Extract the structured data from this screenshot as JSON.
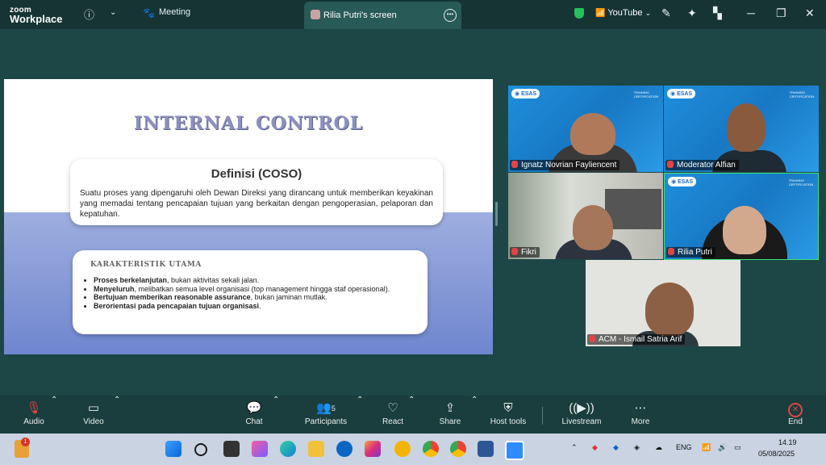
{
  "titlebar": {
    "logo_line1": "zoom",
    "logo_line2": "Workplace",
    "meeting_label": "Meeting",
    "screen_tab_label": "Rilia Putri's screen",
    "youtube_label": "YouTube"
  },
  "slide": {
    "title": "INTERNAL CONTROL",
    "card1_heading": "Definisi (COSO)",
    "card1_text": "Suatu proses yang dipengaruhi oleh Dewan Direksi yang dirancang untuk memberikan keyakinan yang memadai tentang pencapaian tujuan yang berkaitan dengan pengoperasian, pelaporan dan kepatuhan.",
    "card2_heading": "KARAKTERISTIK UTAMA",
    "bullets": [
      {
        "bold": "Proses berkelanjutan",
        "rest": ", bukan aktivitas sekali jalan."
      },
      {
        "bold": "Menyeluruh",
        "rest": ", melibatkan semua level organisasi (top management hingga staf operasional)."
      },
      {
        "bold": "Bertujuan memberikan reasonable assurance",
        "rest": ", bukan jaminan mutlak."
      },
      {
        "bold": "Berorientasi pada pencapaian tujuan organisasi",
        "rest": "."
      }
    ]
  },
  "participants": [
    {
      "name": "Ignatz Novrian Fayliencent"
    },
    {
      "name": "Moderator Alfian"
    },
    {
      "name": "Fikri"
    },
    {
      "name": "Rilia Putri"
    },
    {
      "name": "ACM - Ismail Satria Arif"
    }
  ],
  "esas_label": "ESAS",
  "toolbar": {
    "audio": "Audio",
    "video": "Video",
    "chat": "Chat",
    "participants": "Participants",
    "participants_count": "5",
    "react": "React",
    "share": "Share",
    "host_tools": "Host tools",
    "livestream": "Livestream",
    "more": "More",
    "end": "End"
  },
  "taskbar": {
    "lang": "ENG",
    "time": "14.19",
    "date": "05/08/2025",
    "badge": "1"
  }
}
